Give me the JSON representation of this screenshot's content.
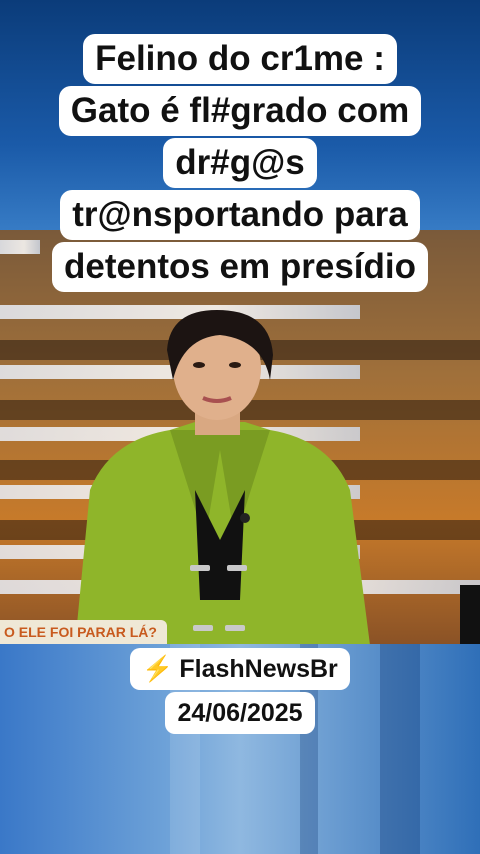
{
  "headline": {
    "lines": [
      "Felino do cr1me :",
      "Gato é fl#grado com",
      "dr#g@s",
      "tr@nsportando para",
      "detentos em presídio"
    ]
  },
  "lower_third": {
    "text": "O ELE FOI PARAR LÁ?"
  },
  "watermark": {
    "icon": "lightning-bolt-icon",
    "channel": "FlashNewsBr",
    "date": "24/06/2025"
  },
  "colors": {
    "anchor_jacket": "#8fb52a",
    "studio_orange": "#c77a2a",
    "lower_third_text": "#c85a1e"
  }
}
